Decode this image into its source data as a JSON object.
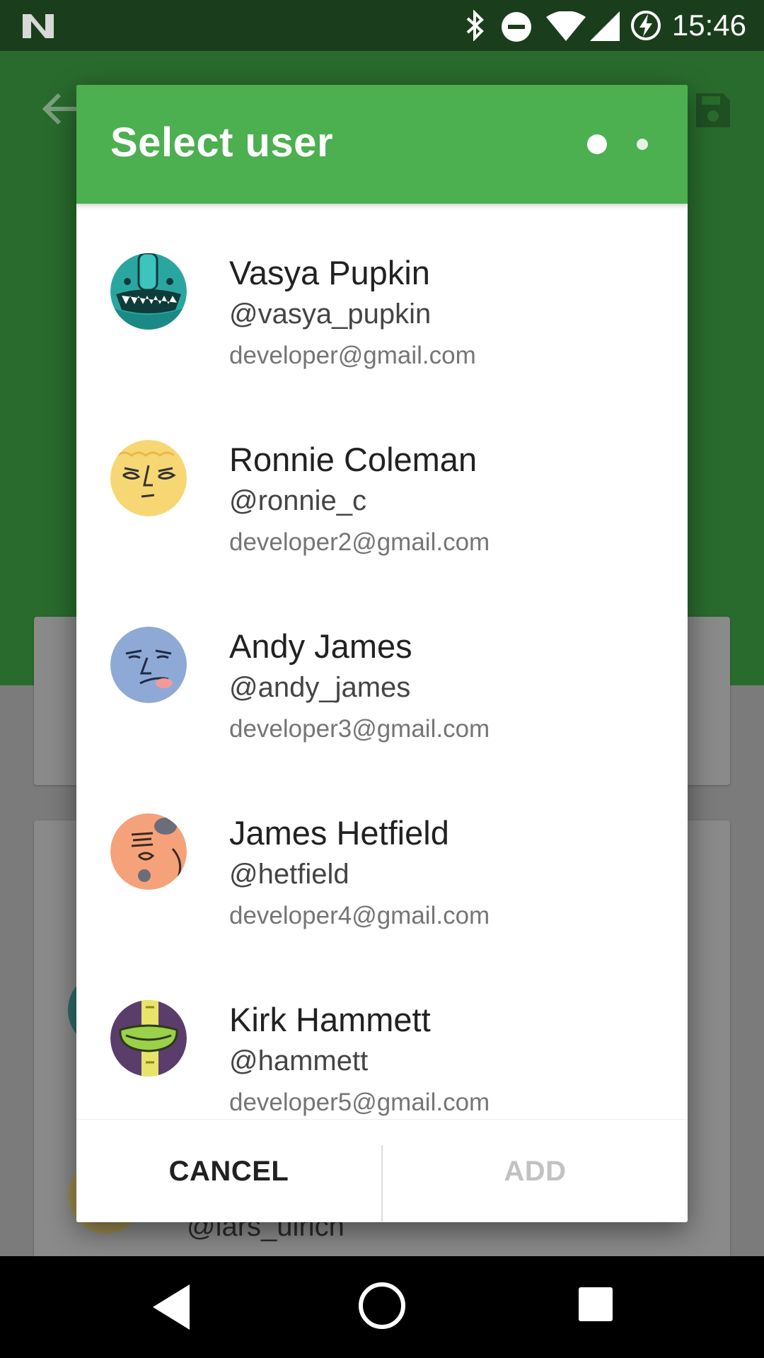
{
  "status_bar": {
    "time": "15:46",
    "icons": [
      "notification-n-icon",
      "bluetooth-icon",
      "do-not-disturb-icon",
      "wifi-icon",
      "signal-icon",
      "battery-charging-icon"
    ]
  },
  "background": {
    "partial_handle": "@lars_ulrich"
  },
  "dialog": {
    "title": "Select user",
    "page_indicator": {
      "pages": 2,
      "active": 1
    },
    "users": [
      {
        "name": "Vasya Pupkin",
        "handle": "@vasya_pupkin",
        "email": "developer@gmail.com",
        "avatar_color": "#2aa6a0"
      },
      {
        "name": "Ronnie Coleman",
        "handle": "@ronnie_c",
        "email": "developer2@gmail.com",
        "avatar_color": "#f7d774"
      },
      {
        "name": "Andy James",
        "handle": "@andy_james",
        "email": "developer3@gmail.com",
        "avatar_color": "#8fa9d6"
      },
      {
        "name": "James Hetfield",
        "handle": "@hetfield",
        "email": "developer4@gmail.com",
        "avatar_color": "#f5a27a"
      },
      {
        "name": "Kirk Hammett",
        "handle": "@hammett",
        "email": "developer5@gmail.com",
        "avatar_color": "#5a3d6b"
      }
    ],
    "cancel_label": "CANCEL",
    "add_label": "ADD"
  },
  "colors": {
    "header": "#4caf50",
    "toolbar_dimmed": "#296b2d",
    "status_bar": "#1a3d1c",
    "add_disabled": "#c2c2c2"
  }
}
